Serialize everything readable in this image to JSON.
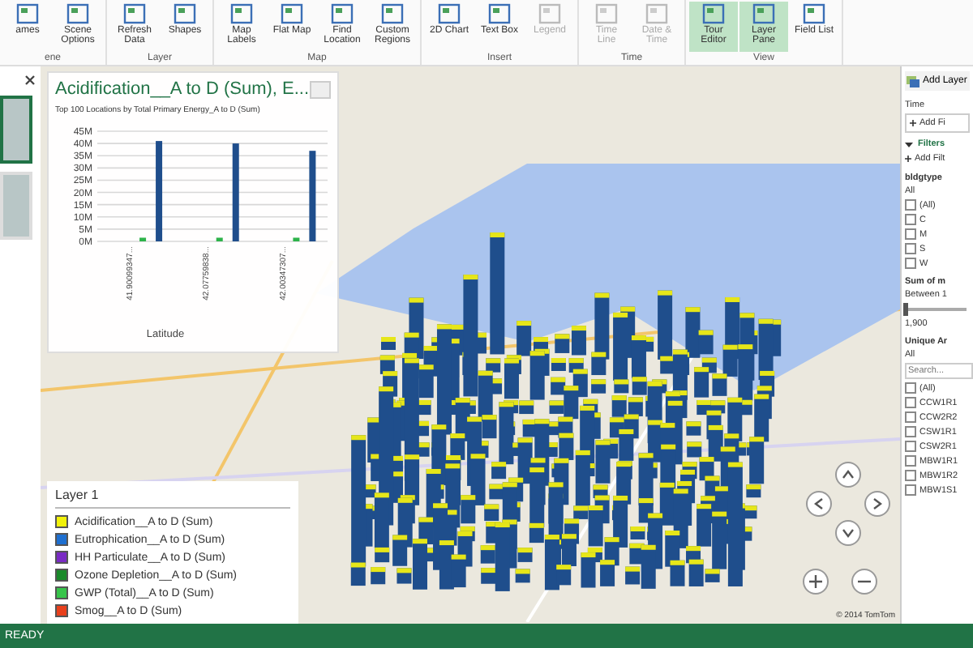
{
  "ribbon": {
    "groups": [
      {
        "label": "ene",
        "buttons": [
          {
            "label": "ames",
            "selected": false,
            "disabled": false
          },
          {
            "label": "Scene Options",
            "selected": false,
            "disabled": false
          }
        ]
      },
      {
        "label": "Layer",
        "buttons": [
          {
            "label": "Refresh Data",
            "selected": false,
            "disabled": false
          },
          {
            "label": "Shapes",
            "selected": false,
            "disabled": false
          }
        ]
      },
      {
        "label": "Map",
        "buttons": [
          {
            "label": "Map Labels",
            "selected": false,
            "disabled": false
          },
          {
            "label": "Flat Map",
            "selected": false,
            "disabled": false
          },
          {
            "label": "Find Location",
            "selected": false,
            "disabled": false
          },
          {
            "label": "Custom Regions",
            "selected": false,
            "disabled": false
          }
        ]
      },
      {
        "label": "Insert",
        "buttons": [
          {
            "label": "2D Chart",
            "selected": false,
            "disabled": false
          },
          {
            "label": "Text Box",
            "selected": false,
            "disabled": false
          },
          {
            "label": "Legend",
            "selected": false,
            "disabled": true
          }
        ]
      },
      {
        "label": "Time",
        "buttons": [
          {
            "label": "Time Line",
            "selected": false,
            "disabled": true
          },
          {
            "label": "Date & Time",
            "selected": false,
            "disabled": true
          }
        ]
      },
      {
        "label": "View",
        "buttons": [
          {
            "label": "Tour Editor",
            "selected": true,
            "disabled": false
          },
          {
            "label": "Layer Pane",
            "selected": true,
            "disabled": false
          },
          {
            "label": "Field List",
            "selected": false,
            "disabled": false
          }
        ]
      }
    ]
  },
  "scenes": [
    {
      "selected": true
    },
    {
      "selected": false
    }
  ],
  "chart_panel": {
    "title": "Acidification__A to D (Sum), E...",
    "subtitle": "Top 100 Locations by Total Primary Energy_A to D (Sum)",
    "chart_data": {
      "type": "bar",
      "grid": true,
      "xlabel": "Latitude",
      "categories": [
        "41.90099347...",
        "42.07759838...",
        "42.00347307..."
      ],
      "series": [
        {
          "color": "#2db34a",
          "values": [
            1.5,
            1.5,
            1.5
          ]
        },
        {
          "color": "#1f4e8c",
          "values": [
            41,
            40,
            37
          ]
        }
      ],
      "ylim": [
        0,
        45
      ],
      "yticks": [
        {
          "value": 0,
          "label": "0M"
        },
        {
          "value": 5,
          "label": "5M"
        },
        {
          "value": 10,
          "label": "10M"
        },
        {
          "value": 15,
          "label": "15M"
        },
        {
          "value": 20,
          "label": "20M"
        },
        {
          "value": 25,
          "label": "25M"
        },
        {
          "value": 30,
          "label": "30M"
        },
        {
          "value": 35,
          "label": "35M"
        },
        {
          "value": 40,
          "label": "40M"
        },
        {
          "value": 45,
          "label": "45M"
        }
      ]
    }
  },
  "legend": {
    "title": "Layer 1",
    "items": [
      {
        "label": "Acidification__A to D (Sum)",
        "color": "#f2f20a"
      },
      {
        "label": "Eutrophication__A to D (Sum)",
        "color": "#1e6fd0"
      },
      {
        "label": "HH Particulate__A to D (Sum)",
        "color": "#7a2bc4"
      },
      {
        "label": "Ozone Depletion__A to D (Sum)",
        "color": "#1a8a2a"
      },
      {
        "label": "GWP (Total)__A to D (Sum)",
        "color": "#37c44a"
      },
      {
        "label": "Smog__A to D (Sum)",
        "color": "#e8401c"
      }
    ]
  },
  "map": {
    "attribution": "© 2014 TomTom"
  },
  "right_pane": {
    "add_layer": "Add Layer",
    "time_label": "Time",
    "add_time": "Add Fi",
    "filters_title": "Filters",
    "filters_expanded": true,
    "add_filter": "Add Filt",
    "filters": [
      {
        "kind": "list",
        "title": "bldgtype",
        "value": "All",
        "options": [
          {
            "label": "(All)",
            "checked": false
          },
          {
            "label": "C",
            "checked": false
          },
          {
            "label": "M",
            "checked": false
          },
          {
            "label": "S",
            "checked": false
          },
          {
            "label": "W",
            "checked": false
          }
        ]
      },
      {
        "kind": "range",
        "title": "Sum of m",
        "value": "Between 1",
        "level": 0.0,
        "reading": "1,900"
      },
      {
        "kind": "list",
        "title": "Unique Ar",
        "value": "All",
        "search": {
          "placeholder": "Search..."
        },
        "options": [
          {
            "label": "(All)",
            "checked": false
          },
          {
            "label": "CCW1R1",
            "checked": false
          },
          {
            "label": "CCW2R2",
            "checked": false
          },
          {
            "label": "CSW1R1",
            "checked": false
          },
          {
            "label": "CSW2R1",
            "checked": false
          },
          {
            "label": "MBW1R1",
            "checked": false
          },
          {
            "label": "MBW1R2",
            "checked": false
          },
          {
            "label": "MBW1S1",
            "checked": false
          }
        ]
      }
    ]
  },
  "status_bar": {
    "text": "READY"
  }
}
